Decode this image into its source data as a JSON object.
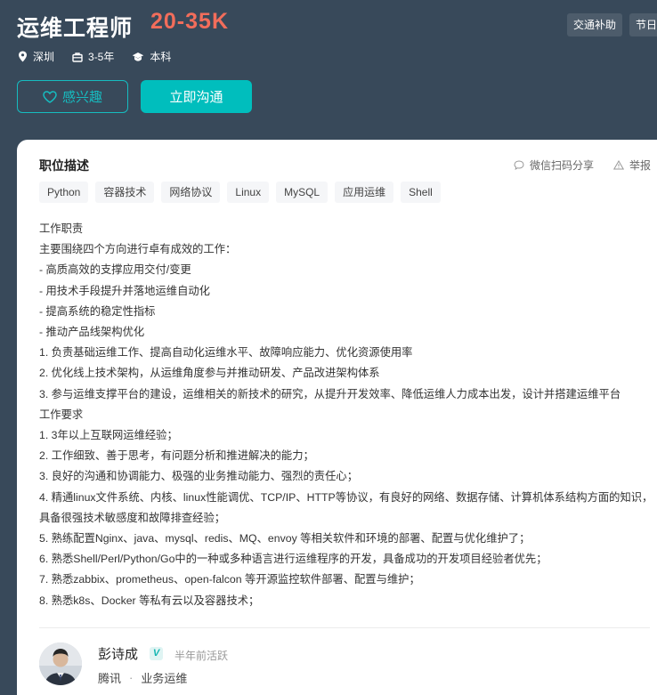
{
  "job": {
    "title": "运维工程师",
    "salary": "20-35K",
    "benefits": [
      "交通补助",
      "节日福利"
    ],
    "location": "深圳",
    "experience": "3-5年",
    "education": "本科"
  },
  "buttons": {
    "interest_label": "感兴趣",
    "chat_label": "立即沟通"
  },
  "detail": {
    "section_title": "职位描述",
    "share_label": "微信扫码分享",
    "report_label": "举报",
    "skill_tags": [
      "Python",
      "容器技术",
      "网络协议",
      "Linux",
      "MySQL",
      "应用运维",
      "Shell"
    ],
    "description_lines": [
      "工作职责",
      "主要围绕四个方向进行卓有成效的工作：",
      "- 高质高效的支撑应用交付/变更",
      "- 用技术手段提升并落地运维自动化",
      "- 提高系统的稳定性指标",
      "- 推动产品线架构优化",
      "1. 负责基础运维工作、提高自动化运维水平、故障响应能力、优化资源使用率",
      "2. 优化线上技术架构，从运维角度参与并推动研发、产品改进架构体系",
      "3. 参与运维支撑平台的建设，运维相关的新技术的研究，从提升开发效率、降低运维人力成本出发，设计并搭建运维平台",
      "工作要求",
      "1. 3年以上互联网运维经验；",
      "2. 工作细致、善于思考，有问题分析和推进解决的能力；",
      "3. 良好的沟通和协调能力、极强的业务推动能力、强烈的责任心；",
      "4. 精通linux文件系统、内核、linux性能调优、TCP/IP、HTTP等协议，有良好的网络、数据存储、计算机体系结构方面的知识，具备很强技术敏感度和故障排查经验；",
      "5. 熟练配置Nginx、java、mysql、redis、MQ、envoy 等相关软件和环境的部署、配置与优化维护了；",
      "6. 熟悉Shell/Perl/Python/Go中的一种或多种语言进行运维程序的开发，具备成功的开发项目经验者优先；",
      "7. 熟悉zabbix、prometheus、open-falcon 等开源监控软件部署、配置与维护；",
      "8. 熟悉k8s、Docker 等私有云以及容器技术；"
    ]
  },
  "recruiter": {
    "name": "彭诗成",
    "verified_badge": "V",
    "active_status": "半年前活跃",
    "company": "腾讯",
    "separator": "·",
    "role": "业务运维"
  },
  "colors": {
    "header_bg": "#38495a",
    "salary": "#f26d5b",
    "accent": "#00bebd"
  }
}
